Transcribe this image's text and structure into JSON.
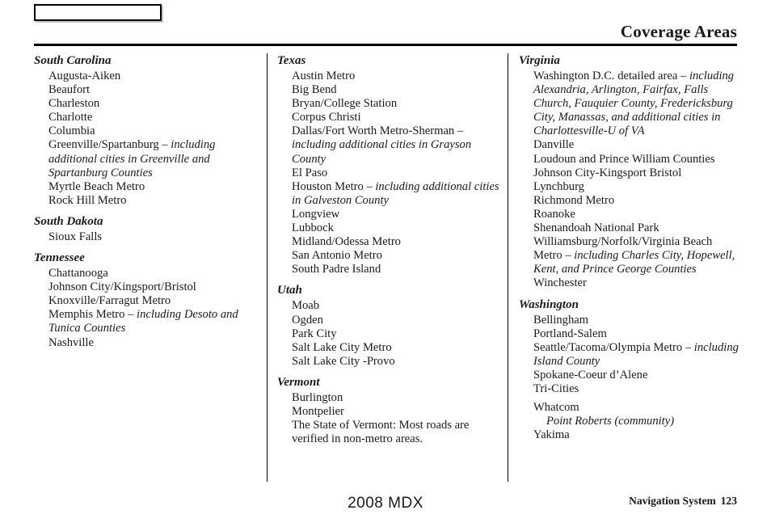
{
  "header": {
    "box_label": "",
    "title": "Coverage Areas"
  },
  "footer": {
    "model": "2008  MDX",
    "manual_name": "Navigation System",
    "page_number": "123"
  },
  "columns": [
    {
      "states": [
        {
          "name": "South Carolina",
          "cities": [
            {
              "text": "Augusta-Aiken"
            },
            {
              "text": "Beaufort"
            },
            {
              "text": "Charleston"
            },
            {
              "text": "Charlotte"
            },
            {
              "text": "Columbia"
            },
            {
              "text": "Greenville/Spartanburg ",
              "note": "– including additional cities in Greenville and Spartanburg Counties"
            },
            {
              "text": "Myrtle Beach Metro"
            },
            {
              "text": "Rock Hill Metro"
            }
          ]
        },
        {
          "name": "South Dakota",
          "cities": [
            {
              "text": "Sioux Falls"
            }
          ]
        },
        {
          "name": "Tennessee",
          "cities": [
            {
              "text": "Chattanooga"
            },
            {
              "text": "Johnson City/Kingsport/Bristol"
            },
            {
              "text": "Knoxville/Farragut Metro"
            },
            {
              "text": "Memphis Metro ",
              "note": "– including Desoto and Tunica Counties"
            },
            {
              "text": "Nashville"
            }
          ]
        }
      ]
    },
    {
      "states": [
        {
          "name": "Texas",
          "cities": [
            {
              "text": "Austin Metro"
            },
            {
              "text": "Big Bend"
            },
            {
              "text": "Bryan/College Station"
            },
            {
              "text": "Corpus Christi"
            },
            {
              "text": "Dallas/Fort Worth Metro-Sherman ",
              "note": "– including additional cities in Grayson County"
            },
            {
              "text": "El Paso"
            },
            {
              "text": "Houston Metro ",
              "note": "– including additional cities in Galveston County"
            },
            {
              "text": "Longview"
            },
            {
              "text": "Lubbock"
            },
            {
              "text": "Midland/Odessa Metro"
            },
            {
              "text": "San Antonio Metro"
            },
            {
              "text": "South Padre Island"
            }
          ]
        },
        {
          "name": "Utah",
          "cities": [
            {
              "text": "Moab"
            },
            {
              "text": "Ogden"
            },
            {
              "text": "Park City"
            },
            {
              "text": "Salt Lake City Metro"
            },
            {
              "text": "Salt Lake City -Provo"
            }
          ]
        },
        {
          "name": "Vermont",
          "cities": [
            {
              "text": "Burlington"
            },
            {
              "text": "Montpelier"
            },
            {
              "text": "The State of Vermont: Most roads are verified in non-metro areas."
            }
          ]
        }
      ]
    },
    {
      "states": [
        {
          "name": "Virginia",
          "cities": [
            {
              "text": "Washington D.C. detailed area ",
              "note": "– including Alexandria, Arlington, Fairfax, Falls Church, Fauquier County, Fredericksburg City, Manassas, and additional cities in Charlottesville-U of VA"
            },
            {
              "text": "Danville"
            },
            {
              "text": "Loudoun and Prince William Counties"
            },
            {
              "text": "Johnson City-Kingsport Bristol"
            },
            {
              "text": "Lynchburg"
            },
            {
              "text": "Richmond Metro"
            },
            {
              "text": "Roanoke"
            },
            {
              "text": "Shenandoah National Park"
            },
            {
              "text": "Williamsburg/Norfolk/Virginia Beach Metro ",
              "note": "– including Charles City, Hopewell, Kent, and Prince George Counties"
            },
            {
              "text": "Winchester"
            }
          ]
        },
        {
          "name": "Washington",
          "cities": [
            {
              "text": "Bellingham"
            },
            {
              "text": "Portland-Salem"
            },
            {
              "text": "Seattle/Tacoma/Olympia Metro ",
              "note": "– including Island County"
            },
            {
              "text": "Spokane-Coeur d’Alene"
            },
            {
              "text": "Tri-Cities"
            },
            {
              "text": "Whatcom",
              "gap_before": true
            },
            {
              "text": "Point Roberts (community)",
              "sub": true
            },
            {
              "text": "Yakima"
            }
          ]
        }
      ]
    }
  ]
}
